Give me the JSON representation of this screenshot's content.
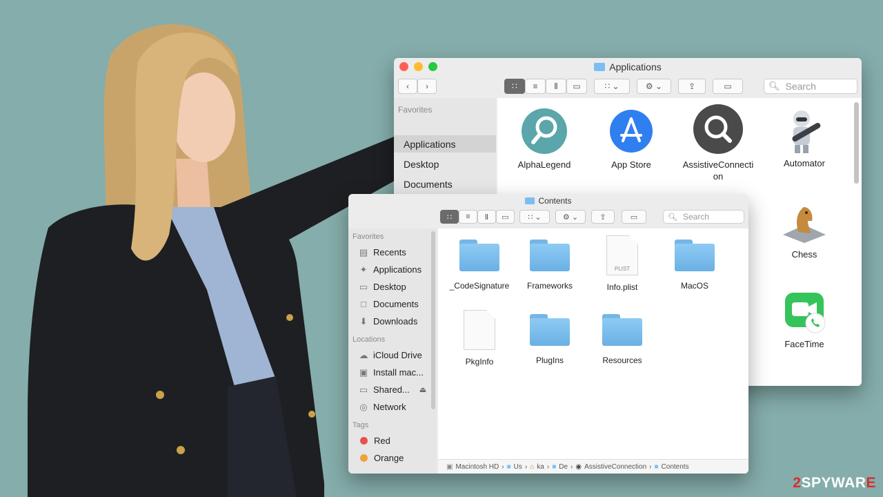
{
  "colors": {
    "background": "#85ADAB",
    "close": "#ff5f57",
    "minimize": "#febc2e",
    "zoom": "#28c840",
    "folder": "#7dbdf0"
  },
  "back_window": {
    "title": "Applications",
    "search_placeholder": "Search",
    "sidebar_header": "Favorites",
    "sidebar_items": [
      "Applications",
      "Desktop",
      "Documents"
    ],
    "apps": [
      {
        "label": "AlphaLegend",
        "icon": "magnifier-teal-icon"
      },
      {
        "label": "App Store",
        "icon": "app-store-icon"
      },
      {
        "label": "AssistiveConnecti",
        "label2": "on",
        "icon": "magnifier-dark-icon"
      },
      {
        "label": "Automator",
        "icon": "automator-robot-icon"
      },
      {
        "label": "Chess",
        "icon": "chess-knight-icon"
      },
      {
        "label": "FaceTime",
        "icon": "facetime-icon"
      }
    ]
  },
  "front_window": {
    "title": "Contents",
    "search_placeholder": "Search",
    "sidebar": {
      "favorites_header": "Favorites",
      "favorites": [
        "Recents",
        "Applications",
        "Desktop",
        "Documents",
        "Downloads"
      ],
      "locations_header": "Locations",
      "locations": [
        "iCloud Drive",
        "Install mac...",
        "Shared...",
        "Network"
      ],
      "tags_header": "Tags",
      "tags": [
        {
          "label": "Red",
          "color": "#e5534b"
        },
        {
          "label": "Orange",
          "color": "#f0a33a"
        }
      ]
    },
    "items": [
      {
        "label": "_CodeSignature",
        "type": "folder"
      },
      {
        "label": "Frameworks",
        "type": "folder"
      },
      {
        "label": "Info.plist",
        "type": "plist",
        "badge": "PLIST"
      },
      {
        "label": "MacOS",
        "type": "folder"
      },
      {
        "label": "PkgInfo",
        "type": "file"
      },
      {
        "label": "PlugIns",
        "type": "folder"
      },
      {
        "label": "Resources",
        "type": "folder"
      }
    ],
    "path": [
      "Macintosh HD",
      "Us",
      "ka",
      "De",
      "AssistiveConnection",
      "Contents"
    ]
  },
  "watermark": {
    "prefix": "2",
    "name": "SPYWAR",
    "suffix": "E"
  }
}
